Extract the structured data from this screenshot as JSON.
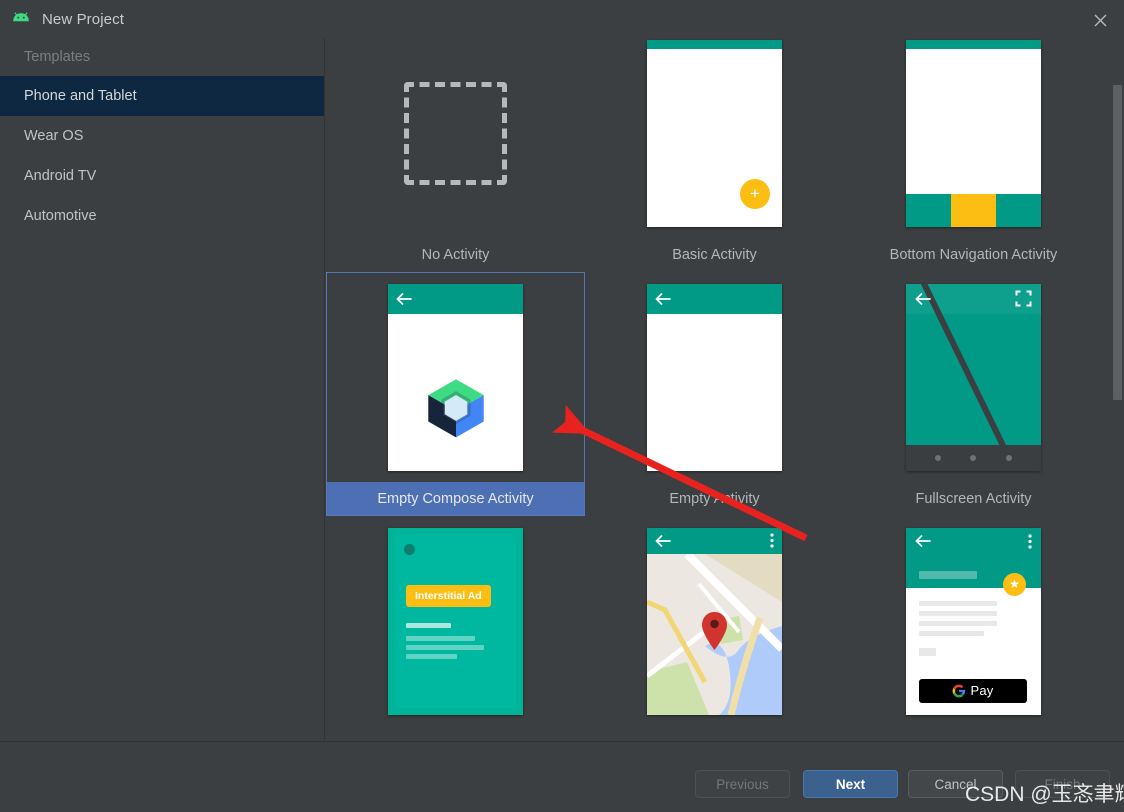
{
  "window": {
    "title": "New Project",
    "app_icon": "android-robot-icon",
    "close_icon": "close-icon"
  },
  "sidebar": {
    "header": "Templates",
    "items": [
      {
        "label": "Phone and Tablet",
        "selected": true
      },
      {
        "label": "Wear OS",
        "selected": false
      },
      {
        "label": "Android TV",
        "selected": false
      },
      {
        "label": "Automotive",
        "selected": false
      }
    ],
    "selected_color": "#0d2840"
  },
  "templates": {
    "rows": [
      [
        {
          "label": "No Activity",
          "thumb": "dashed-box",
          "selected": false
        },
        {
          "label": "Basic Activity",
          "thumb": "basic-activity",
          "selected": false
        },
        {
          "label": "Bottom Navigation Activity",
          "thumb": "bottom-navigation",
          "selected": false
        }
      ],
      [
        {
          "label": "Empty Compose Activity",
          "thumb": "compose-cube",
          "selected": true
        },
        {
          "label": "Empty Activity",
          "thumb": "empty-activity",
          "selected": false
        },
        {
          "label": "Fullscreen Activity",
          "thumb": "fullscreen-activity",
          "selected": false
        }
      ],
      [
        {
          "label": "",
          "thumb": "interstitial-ad",
          "selected": false
        },
        {
          "label": "",
          "thumb": "google-maps",
          "selected": false
        },
        {
          "label": "",
          "thumb": "google-pay",
          "selected": false
        }
      ]
    ],
    "ad_badge_label": "Interstitial Ad",
    "gpay_label": "Pay"
  },
  "footer": {
    "buttons": [
      {
        "label": "Previous",
        "state": "disabled"
      },
      {
        "label": "Next",
        "state": "primary"
      },
      {
        "label": "Cancel",
        "state": "normal"
      },
      {
        "label": "Finish",
        "state": "disabled"
      }
    ]
  },
  "annotations": {
    "watermark": "CSDN @玉忞聿辉",
    "arrow_color": "#e8221f"
  },
  "colors": {
    "dialog_bg": "#3c3f41",
    "accent_green": "#009a86",
    "accent_yellow": "#fdbe14",
    "selection_blue": "#4d6fb3",
    "sidebar_selection": "#0d2840"
  }
}
